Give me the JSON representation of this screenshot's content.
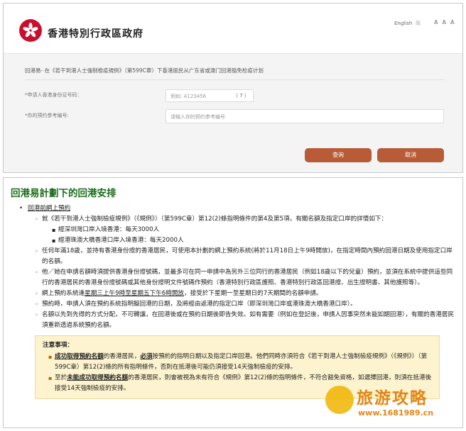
{
  "form": {
    "logo_text": "香港特別行政區政府",
    "language": "English",
    "lang_sep": "简",
    "font_sizes": [
      "A",
      "A",
      "A"
    ],
    "title": "回港易- 在《若干到港人士強制檢疫規例》（第599C章）下香港居民从广东省或澳门回港豁免检疫计划",
    "hkid_label": "*申请人香港身份证号码：",
    "hkid_placeholder": "例如: A123456",
    "hkid_check": "（ 7 ）",
    "ref_label": "*你的预约参考编号:",
    "ref_placeholder": "请输入你的预约参考编号",
    "search_button": "查询",
    "cancel_button": "取消"
  },
  "info": {
    "title": "回港易計劃下的回港安排",
    "section_heading": "回港前網上預約",
    "items": [
      "就《若干到港人士強制檢疫規例》（《規例》）（第599C章）第12(2)條指明條件的第4及第5項，有關名額及指定口岸的詳情如下：",
      "任何年滿18歲，並持有香港身份證的香港居民，可使用本計劃的網上預約系統(將於11月18日上午9時開放)，在指定時間內預約回港日期及使用指定口岸的名額。",
      "他／她在申請名額時須提供香港身份證號碼，並最多可在同一申請中為另外三位同行的香港居民（例如18歲以下的兒童）預約，並須在系統中提供這些同行的香港居民的香港身份證號碼或其他身份證明文件號碼作預約（香港特別行政區護照、香港特別行政區回港證、出生證明書、其他護照等）。",
      "預約時，申請人須在預約系統指明擬回港的日期，及將經由返港的指定口岸（即深圳灣口岸或港珠澳大橋香港口岸）。",
      "名額以先到先得的方式分配，不可轉讓，在回港後或在預約日期後即告失效。如有需要（例如在登記後，申請人因事突然未能如期回港），有關的香港居民須重新透過系統預約名額。"
    ],
    "quotas": [
      "經深圳灣口岸入境香港：每天3000人",
      "經港珠澳大橋香港口岸入境香港：每天2000人"
    ],
    "system_pre": "網上預約系統逢",
    "system_underline": "星期三上午9時至星期五下午6時開放",
    "system_post": "，接受於下星期一至星期日的7天期間的名額申請。",
    "notice_title": "注意事項：",
    "notice1_a": "成功取得預約名額",
    "notice1_b": "的香港居民，",
    "notice1_c": "必須",
    "notice1_d": "按預約的指明日期以及指定口岸回港。他們同時亦須符合《若干到港人士強制檢疫規例》（《規例》）（第599C章）第12(2)條的所有指明條件，否則在抵港後可能仍須接受14天強制檢疫的安排。",
    "notice2_a": "至於",
    "notice2_b": "未能成功取得預約名額",
    "notice2_c": "的香港居民，則會被視為未有符合《規例》第12(2)條的指明條件，不符合豁免資格，如選擇回港，則須在抵港後接受14天強制檢疫的安排。"
  },
  "watermark": {
    "main": "旅游攻略",
    "url": "www.1681989.cn"
  }
}
